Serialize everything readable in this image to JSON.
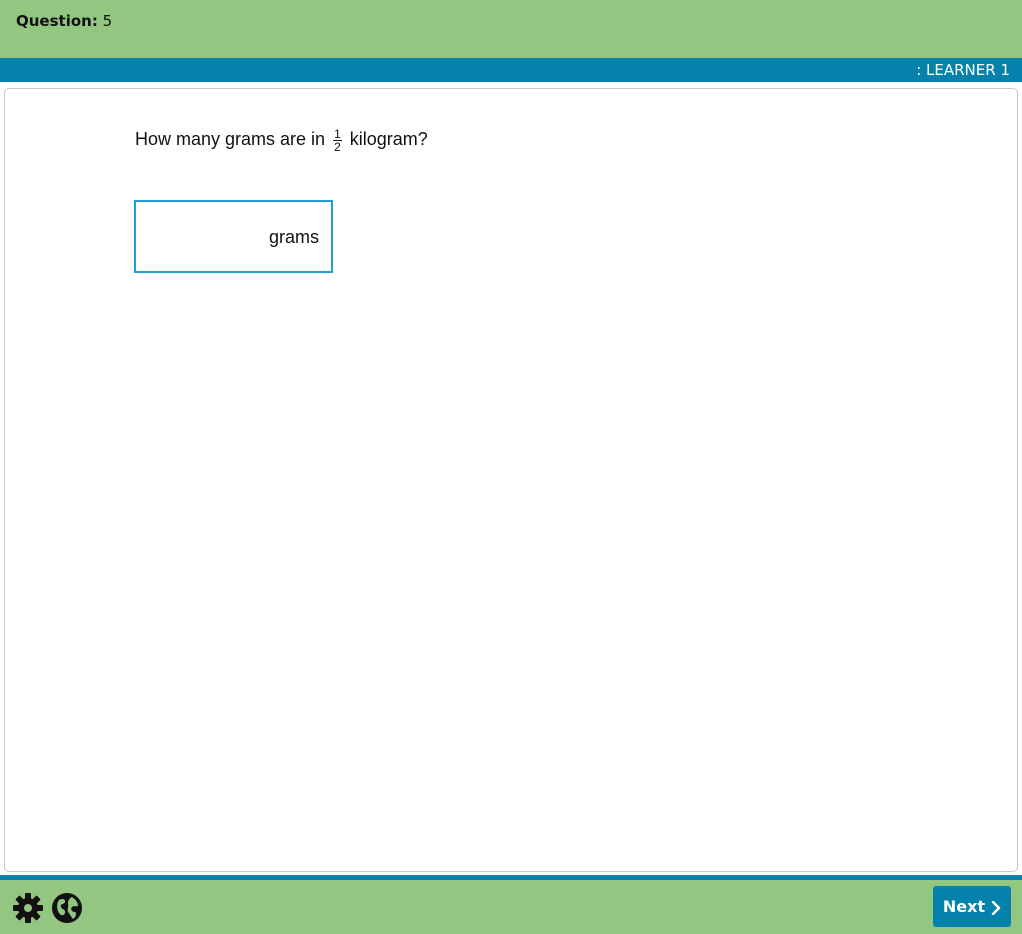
{
  "header": {
    "question_key": "Question:",
    "question_number": "5",
    "learner_label": ": LEARNER 1"
  },
  "question": {
    "prompt_before": "How many grams are in",
    "fraction_numerator": "1",
    "fraction_denominator": "2",
    "prompt_after": "kilogram?",
    "answer_value": "",
    "answer_unit": "grams"
  },
  "footer": {
    "settings_icon": "gear-icon",
    "language_icon": "globe-icon",
    "next_label": "Next",
    "next_icon": "chevron-right-icon"
  },
  "colors": {
    "header_bg": "#92c681",
    "learner_bar_bg": "#0482ab",
    "answer_border": "#1f9fd6",
    "next_button_bg": "#0482ab"
  }
}
